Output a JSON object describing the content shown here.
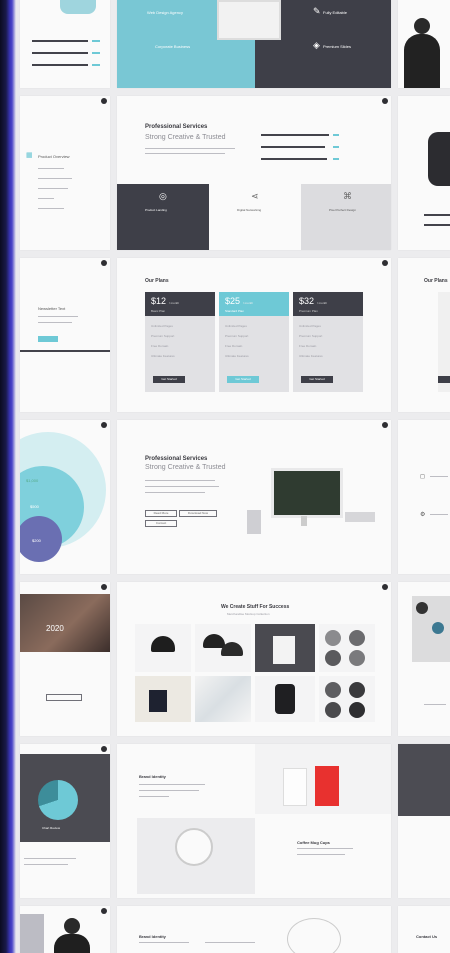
{
  "gallery": {
    "row1": {
      "center_left_items": [
        "Web Design Agency",
        "Corporate Business"
      ],
      "center_right_items": [
        "Fully Editable",
        "Premium Slides"
      ]
    },
    "row2": {
      "left_heading": "Product Overview",
      "title": "Professional Services",
      "subtitle": "Strong Creative & Trusted",
      "features": [
        "Product Landing",
        "Digital Networking",
        "Pixel Perfect Design"
      ]
    },
    "row3": {
      "left_heading": "Newsletter Text",
      "title": "Our Plans",
      "right_title": "Our Plans",
      "plans": [
        {
          "price": "$12",
          "period": "/ month",
          "label": "Basic Plan",
          "button": "Get Started"
        },
        {
          "price": "$25",
          "period": "/ month",
          "label": "Standard Plan",
          "button": "Get Started"
        },
        {
          "price": "$32",
          "period": "/ month",
          "label": "Premium Plan",
          "button": "Get Started"
        }
      ],
      "features": [
        "Unlimited Pages",
        "Premium Support",
        "Free Domain",
        "Ultimate Features"
      ]
    },
    "row4": {
      "venn": [
        "$1,000",
        "$500",
        "$200"
      ],
      "title": "Professional Services",
      "subtitle": "Strong Creative & Trusted",
      "buttons": [
        "Read More",
        "Download Now",
        "Contact"
      ]
    },
    "row5": {
      "left_number": "2020",
      "title": "We Create Stuff For Success",
      "subtitle": "Merchandise Mockup Collection"
    },
    "row6": {
      "left_heading": "Chart Review",
      "center_heading": "Brand Identity",
      "mug_heading": "Coffee Mug Cups"
    },
    "row7": {
      "heading": "Brand Identity",
      "right_heading": "Contact Us"
    }
  },
  "colors": {
    "teal": "#6ec9d6",
    "dark": "#3e3f48",
    "background": "#ececee",
    "red": "#e8312f"
  }
}
